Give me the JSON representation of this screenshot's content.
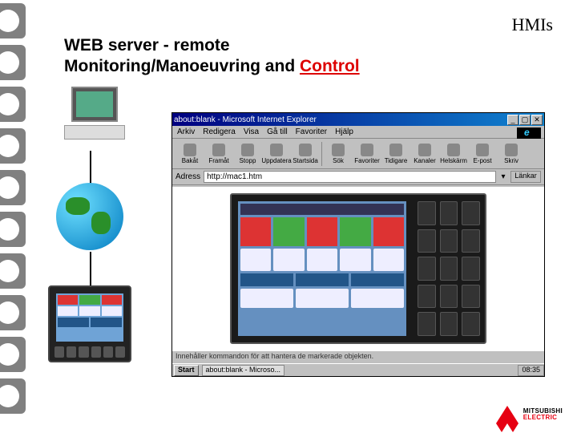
{
  "header": {
    "corner": "HMIs"
  },
  "title": {
    "line1": "WEB server - remote",
    "line2_a": "Monitoring/Manoeuvring and ",
    "line2_b": "Control"
  },
  "ie": {
    "title": "about:blank - Microsoft Internet Explorer",
    "menu": [
      "Arkiv",
      "Redigera",
      "Visa",
      "Gå till",
      "Favoriter",
      "Hjälp"
    ],
    "toolbar": [
      "Bakåt",
      "Framåt",
      "Stopp",
      "Uppdatera",
      "Startsida",
      "Sök",
      "Favoriter",
      "Tidigare",
      "Kanaler",
      "Helskärm",
      "E-post",
      "Skriv"
    ],
    "addr_label": "Adress",
    "addr_value": "http://mac1.htm",
    "links_label": "Länkar",
    "status": "Innehåller kommandon för att hantera de markerade objekten.",
    "start": "Start",
    "task": "about:blank - Microso...",
    "clock": "08:35",
    "ctrl": {
      "min": "_",
      "max": "▢",
      "close": "✕"
    }
  },
  "logo": {
    "top": "MITSUBISHI",
    "bottom": "ELECTRIC"
  }
}
